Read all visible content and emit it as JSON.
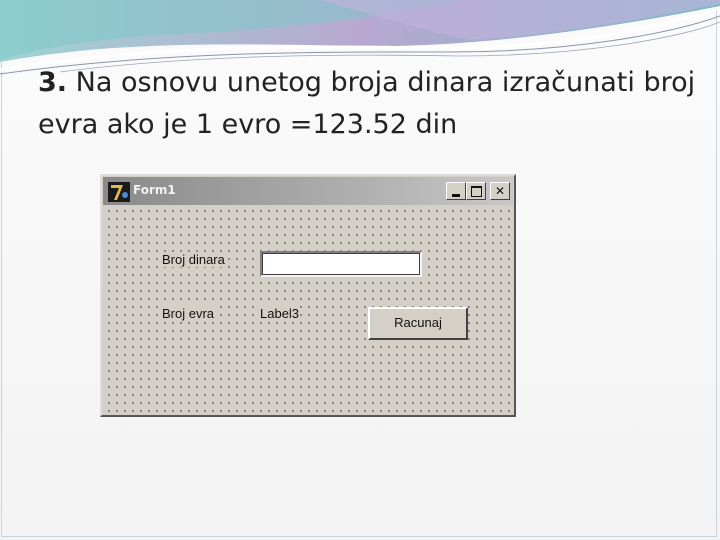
{
  "slide": {
    "number": "3.",
    "title": "Na osnovu unetog broja dinara izračunati broj evra ako je 1 evro =123.52 din"
  },
  "form": {
    "title": "Form1",
    "controls": {
      "minimize": "_",
      "maximize": "□",
      "close": "✕"
    },
    "label_dinara": "Broj dinara",
    "input_dinara_value": "",
    "label_evra": "Broj evra",
    "label3": "Label3",
    "button_racunaj": "Racunaj"
  },
  "icons": [
    "delphi-app-icon",
    "minimize-icon",
    "maximize-icon",
    "close-icon"
  ],
  "colors": {
    "form_face": "#d4d0c8",
    "titlebar_inactive": "#8a8a8a",
    "swoosh_accent": "#7ec7c9"
  }
}
